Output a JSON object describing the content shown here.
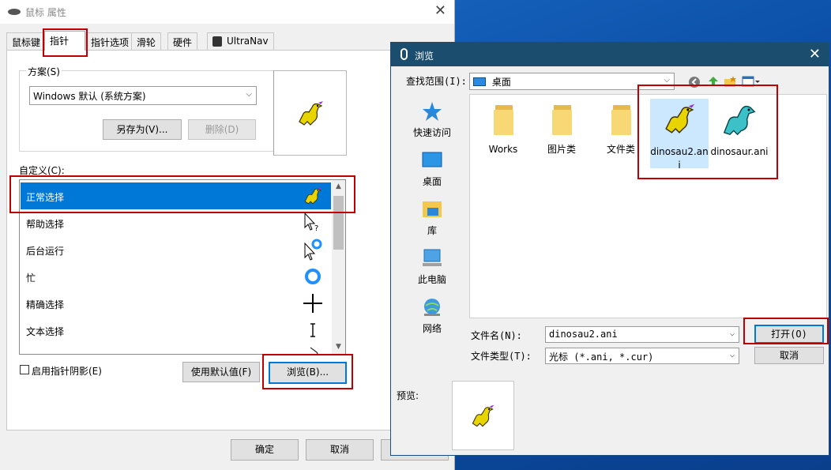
{
  "mouse_window": {
    "title": "鼠标 属性",
    "tabs": [
      "鼠标键",
      "指针",
      "指针选项",
      "滑轮",
      "硬件",
      "UltraNav"
    ],
    "scheme_label": "方案(S)",
    "scheme_value": "Windows 默认 (系统方案)",
    "save_as_label": "另存为(V)...",
    "delete_label": "删除(D)",
    "customize_label": "自定义(C):",
    "cursor_items": [
      {
        "label": "正常选择",
        "icon": "dinosaur-cursor-icon"
      },
      {
        "label": "帮助选择",
        "icon": "help-cursor-icon"
      },
      {
        "label": "后台运行",
        "icon": "working-in-background-cursor-icon"
      },
      {
        "label": "忙",
        "icon": "busy-cursor-icon"
      },
      {
        "label": "精确选择",
        "icon": "precision-crosshair-icon"
      },
      {
        "label": "文本选择",
        "icon": "text-ibeam-icon"
      }
    ],
    "shadow_checkbox_label": "启用指针阴影(E)",
    "use_default_label": "使用默认值(F)",
    "browse_label": "浏览(B)...",
    "ok_label": "确定",
    "cancel_label": "取消"
  },
  "browse_dialog": {
    "title": "浏览",
    "look_in_label": "查找范围(I):",
    "look_in_value": "桌面",
    "places": [
      "快速访问",
      "桌面",
      "库",
      "此电脑",
      "网络"
    ],
    "files": [
      {
        "name": "Works",
        "type": "folder"
      },
      {
        "name": "图片类",
        "type": "folder"
      },
      {
        "name": "文件类",
        "type": "folder"
      },
      {
        "name": "dinosau2.ani",
        "type": "cursor",
        "selected": true
      },
      {
        "name": "dinosaur.ani",
        "type": "cursor"
      }
    ],
    "filename_label": "文件名(N):",
    "filename_value": "dinosau2.ani",
    "filetype_label": "文件类型(T):",
    "filetype_value": "光标 (*.ani, *.cur)",
    "open_label": "打开(O)",
    "cancel_label": "取消",
    "preview_label": "预览:"
  },
  "colors": {
    "selection": "#0078d7",
    "highlight_frame": "#c00000",
    "dialog_titlebar": "#1a4d6e"
  }
}
